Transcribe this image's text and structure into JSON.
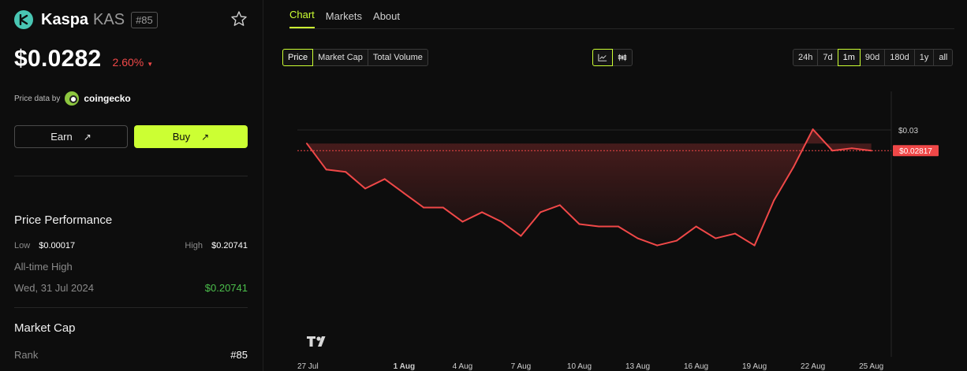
{
  "coin": {
    "name": "Kaspa",
    "symbol": "KAS",
    "rank_tag": "#85",
    "price": "$0.0282",
    "change": "2.60%",
    "price_data_by": "Price data by",
    "provider": "coingecko"
  },
  "actions": {
    "earn": "Earn",
    "buy": "Buy"
  },
  "performance": {
    "title": "Price Performance",
    "low_label": "Low",
    "low_value": "$0.00017",
    "high_label": "High",
    "high_value": "$0.20741",
    "ath_label": "All-time High",
    "ath_date": "Wed, 31 Jul 2024",
    "ath_value": "$0.20741"
  },
  "market_cap": {
    "title": "Market Cap",
    "rank_label": "Rank",
    "rank_value": "#85"
  },
  "tabs": [
    "Chart",
    "Markets",
    "About"
  ],
  "metric_toggle": [
    "Price",
    "Market Cap",
    "Total Volume"
  ],
  "ranges": [
    "24h",
    "7d",
    "1m",
    "90d",
    "180d",
    "1y",
    "all"
  ],
  "colors": {
    "accent": "#ccff33",
    "down": "#f04848",
    "up": "#4cbf4c"
  },
  "icons": {
    "chart_line": "line-chart-icon",
    "chart_candle": "candlestick-icon",
    "watermark": "tradingview-logo"
  },
  "chart_data": {
    "type": "line",
    "x_tick_labels": [
      "27 Jul",
      "1 Aug",
      "4 Aug",
      "7 Aug",
      "10 Aug",
      "13 Aug",
      "16 Aug",
      "19 Aug",
      "22 Aug",
      "25 Aug"
    ],
    "y_tick_labels": [
      "$0.03"
    ],
    "current_price_label": "$0.02817",
    "x_range": [
      0,
      29.5
    ],
    "y_range": [
      0.0201,
      0.0313
    ],
    "x": [
      0,
      1,
      2,
      3,
      4,
      5,
      6,
      7,
      8,
      9,
      10,
      11,
      12,
      13,
      14,
      15,
      16,
      17,
      18,
      19,
      20,
      21,
      22,
      23,
      24,
      25,
      26,
      27,
      28,
      29
    ],
    "y": [
      0.0291,
      0.028,
      0.0279,
      0.0272,
      0.0276,
      0.027,
      0.0264,
      0.0264,
      0.0258,
      0.0262,
      0.0258,
      0.0252,
      0.0262,
      0.0265,
      0.0257,
      0.0256,
      0.0256,
      0.0251,
      0.0248,
      0.025,
      0.0256,
      0.0251,
      0.0253,
      0.0248,
      0.0267,
      0.0281,
      0.0297,
      0.0288,
      0.0289,
      0.0288,
      0.0282
    ],
    "legend": "none",
    "grid": "off"
  }
}
